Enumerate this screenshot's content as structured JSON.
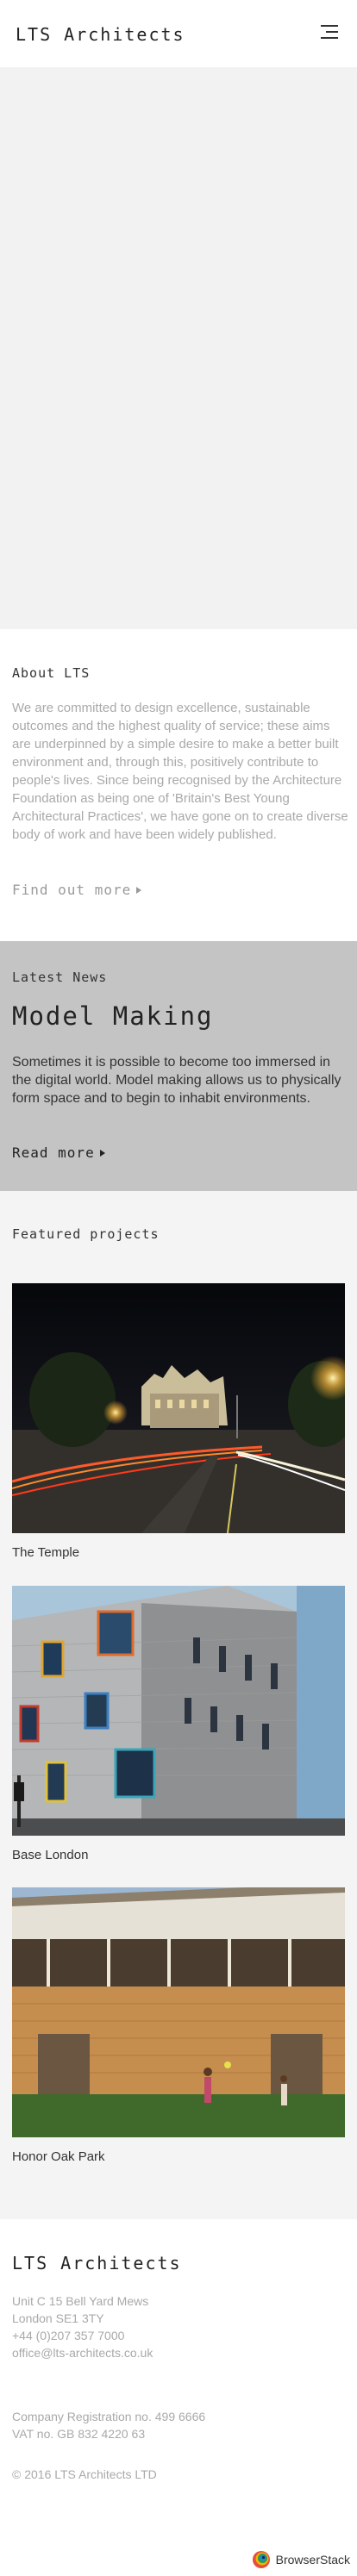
{
  "header": {
    "logo": "LTS Architects",
    "menu_icon": "hamburger-menu-icon"
  },
  "about": {
    "label": "About LTS",
    "text": "We are committed to design excellence, sustainable outcomes and the highest quality of service; these aims are underpinned by a simple desire to make a better built environment and, through this, positively contribute to people's lives. Since being recognised by the Architecture Foundation as being one of 'Britain's Best Young Architectural Practices', we have gone on to create diverse body of work and have been widely published.",
    "link": "Find out more"
  },
  "news": {
    "label": "Latest News",
    "title": "Model Making",
    "text": "Sometimes it is possible to become too immersed in the digital world. Model making allows us to physically form space and to begin to inhabit environments.",
    "link": "Read more"
  },
  "projects": {
    "label": "Featured projects",
    "items": [
      {
        "caption": "The Temple"
      },
      {
        "caption": "Base London"
      },
      {
        "caption": "Honor Oak Park"
      }
    ]
  },
  "footer": {
    "logo": "LTS Architects",
    "address": [
      "Unit C 15 Bell Yard Mews",
      "London SE1 3TY",
      "+44 (0)207 357 7000",
      "office@lts-architects.co.uk"
    ],
    "registration": [
      "Company Registration no. 499 6666",
      "VAT no. GB 832 4220 63"
    ],
    "copyright": "© 2016 LTS Architects LTD",
    "badge": "BrowserStack"
  },
  "colors": {
    "news_bg": "#c4c4c4",
    "muted_text": "#a9a9a9",
    "header_bg": "#ffffff"
  }
}
